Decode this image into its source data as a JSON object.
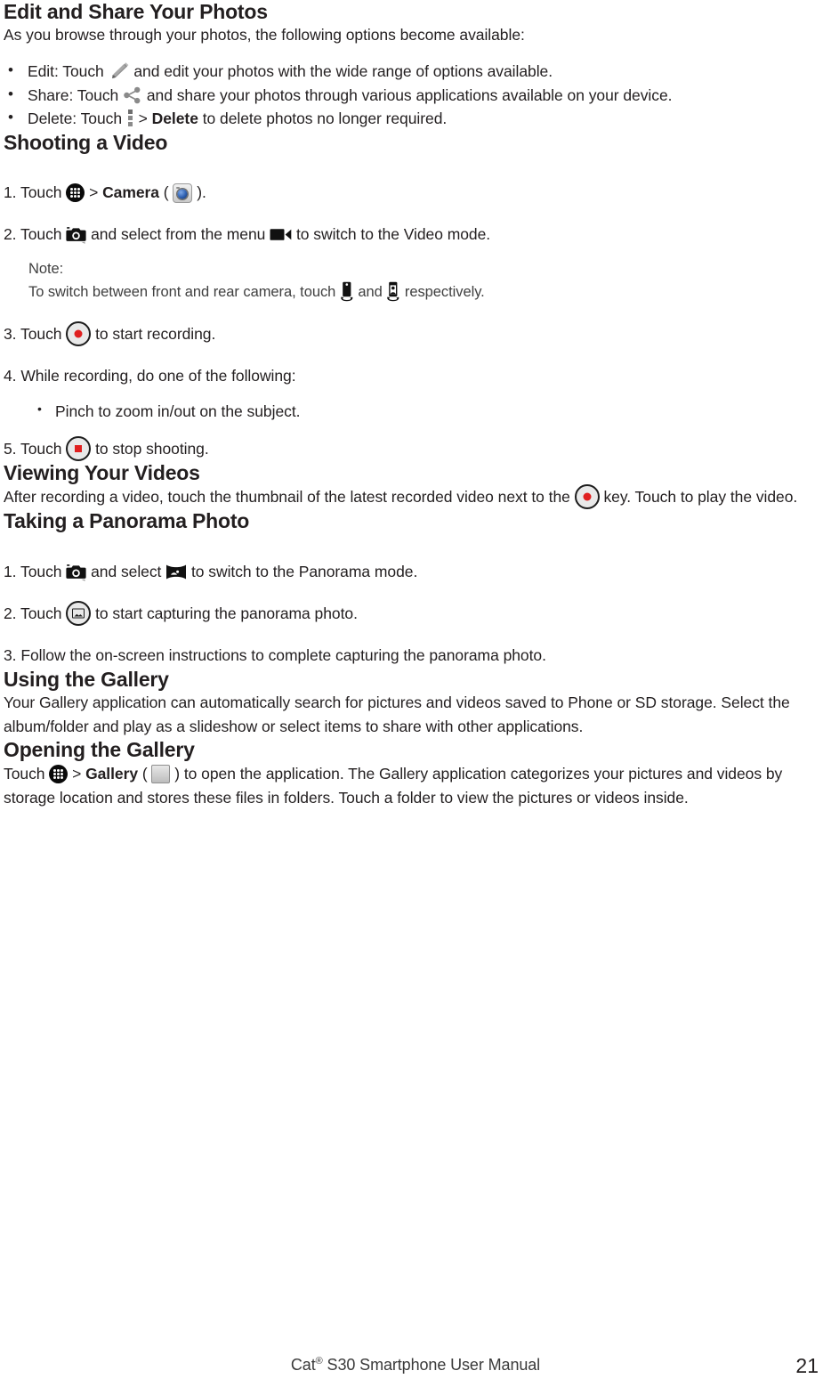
{
  "document": {
    "footer_title_pre": "Cat",
    "footer_title_sup": "®",
    "footer_title_post": " S30 Smartphone User Manual",
    "page_number": "21"
  },
  "sections": [
    {
      "heading": "Edit and Share Your Photos",
      "intro": "As you browse through your photos, the following options become available:",
      "bullets": [
        {
          "pre": "Edit: Touch",
          "icon": "edit-pencil-icon",
          "post": "and edit your photos with the wide range of options available."
        },
        {
          "pre": "Share: Touch",
          "icon": "share-icon",
          "post": "and share your photos through various applications available on your device."
        },
        {
          "pre": "Delete: Touch",
          "icon": "overflow-menu-icon",
          "separator": ">",
          "bold": "Delete",
          "post": "to delete photos no longer required."
        }
      ]
    },
    {
      "heading": "Shooting a Video",
      "steps": [
        {
          "number": "1.",
          "pre": "Touch",
          "icon": "app-drawer-icon",
          "separator": ">",
          "bold": "Camera",
          "paren_open": "(",
          "icon2": "camera-app-icon",
          "paren_close": ")."
        },
        {
          "number": "2.",
          "pre": "Touch",
          "icon": "camera-shutter-icon",
          "mid": "and select from the menu",
          "icon2": "video-camcorder-icon",
          "post": "to switch to the Video mode."
        },
        {
          "number": "3.",
          "pre": "Touch",
          "icon": "record-button-icon",
          "post": "to start recording."
        },
        {
          "number": "4.",
          "pre": "While recording, do one of the following:"
        },
        {
          "number": "5.",
          "pre": "Touch",
          "icon": "stop-button-icon",
          "post": "to stop shooting."
        }
      ],
      "note_label": "Note:",
      "note_pre": "To switch between front and rear camera, touch",
      "note_icon1": "front-camera-flip-icon",
      "note_mid": "and",
      "note_icon2": "rear-camera-flip-icon",
      "note_post": "respectively.",
      "sub_bullet": "Pinch to zoom in/out on the subject."
    },
    {
      "heading": "Viewing Your Videos",
      "paragraph_pre": "After recording a video, touch the thumbnail of the latest recorded video next to the",
      "paragraph_icon": "record-button-icon",
      "paragraph_post": "key. Touch to play the video."
    },
    {
      "heading": "Taking a Panorama Photo",
      "steps": [
        {
          "number": "1.",
          "pre": "Touch",
          "icon": "camera-shutter-icon",
          "mid": "and select",
          "icon2": "panorama-mode-icon",
          "post": "to switch to the Panorama mode."
        },
        {
          "number": "2.",
          "pre": "Touch",
          "icon": "panorama-capture-button-icon",
          "post": "to start capturing the panorama photo."
        },
        {
          "number": "3.",
          "pre": "Follow the on-screen instructions to complete capturing the panorama photo."
        }
      ]
    },
    {
      "heading": "Using the Gallery",
      "paragraph": "Your Gallery application can automatically search for pictures and videos saved to Phone or SD storage. Select the album/folder and play as a slideshow or select items to share with other applications."
    },
    {
      "heading": "Opening the Gallery",
      "paragraph_pre": "Touch",
      "icon": "app-drawer-icon",
      "separator": ">",
      "bold": "Gallery",
      "paren_open": "(",
      "icon2": "gallery-app-icon",
      "paragraph_post": ") to open the application. The Gallery application categorizes your pictures and videos by storage location and stores these files in folders. Touch a folder to view the pictures or videos inside."
    }
  ],
  "colors": {
    "text": "#231f20",
    "icon_gray": "#8a8a8a",
    "record_red": "#e02020"
  }
}
